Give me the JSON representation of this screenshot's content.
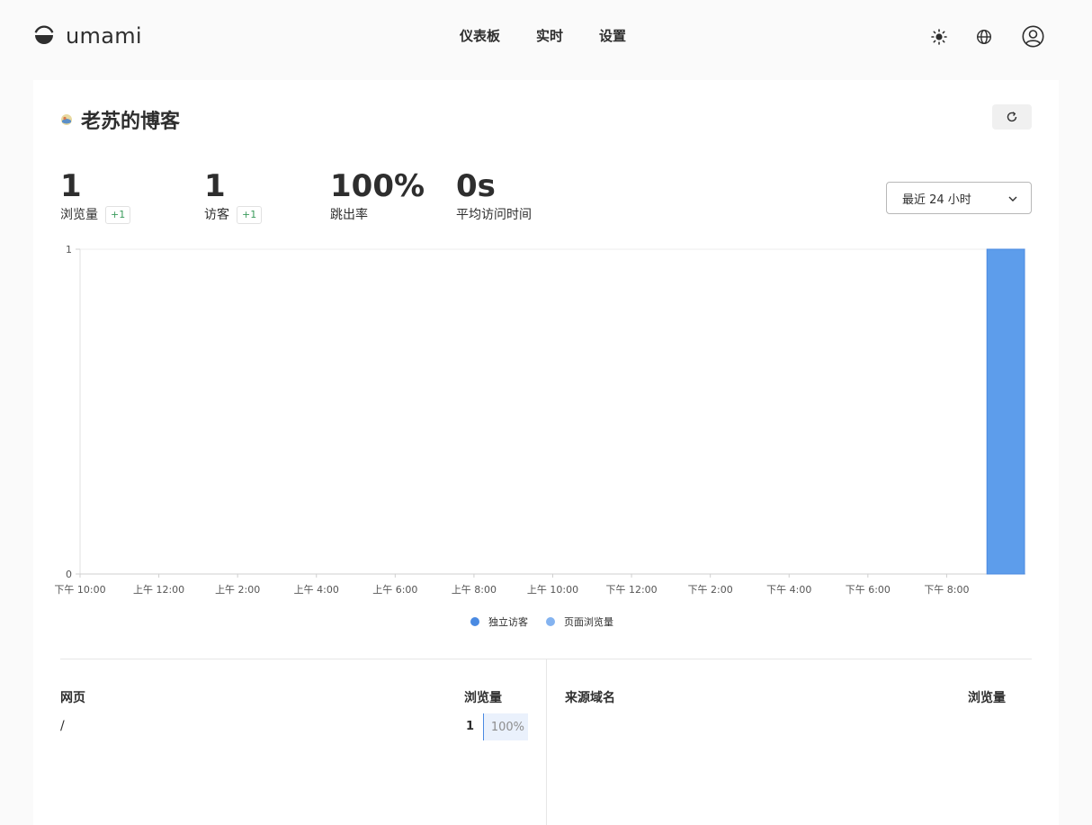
{
  "app": {
    "name": "umami"
  },
  "nav": {
    "items": [
      "仪表板",
      "实时",
      "设置"
    ]
  },
  "site": {
    "name": "老苏的博客"
  },
  "metrics": [
    {
      "value": "1",
      "label": "浏览量",
      "change": "+1"
    },
    {
      "value": "1",
      "label": "访客",
      "change": "+1"
    },
    {
      "value": "100%",
      "label": "跳出率"
    },
    {
      "value": "0s",
      "label": "平均访问时间"
    }
  ],
  "range": {
    "selected": "最近 24 小时"
  },
  "chart_data": {
    "type": "bar",
    "categories": [
      "下午 10:00",
      "上午 12:00",
      "上午 2:00",
      "上午 4:00",
      "上午 6:00",
      "上午 8:00",
      "上午 10:00",
      "下午 12:00",
      "下午 2:00",
      "下午 4:00",
      "下午 6:00",
      "下午 8:00"
    ],
    "series": [
      {
        "name": "独立访客",
        "color": "#4a8ae2",
        "values": [
          0,
          0,
          0,
          0,
          0,
          0,
          0,
          0,
          0,
          0,
          0,
          0,
          0,
          0,
          0,
          0,
          0,
          0,
          0,
          0,
          0,
          0,
          0,
          1
        ]
      },
      {
        "name": "页面浏览量",
        "color": "#84b3f0",
        "values": [
          0,
          0,
          0,
          0,
          0,
          0,
          0,
          0,
          0,
          0,
          0,
          0,
          0,
          0,
          0,
          0,
          0,
          0,
          0,
          0,
          0,
          0,
          0,
          1
        ]
      }
    ],
    "ylim": [
      0,
      1
    ],
    "yticks": [
      "0",
      "1"
    ],
    "grid": false,
    "legend": "bottom"
  },
  "pages_table": {
    "title": "网页",
    "metric": "浏览量",
    "rows": [
      {
        "label": "/",
        "value": "1",
        "percent": "100%"
      }
    ]
  },
  "referrers_table": {
    "title": "来源域名",
    "metric": "浏览量"
  }
}
